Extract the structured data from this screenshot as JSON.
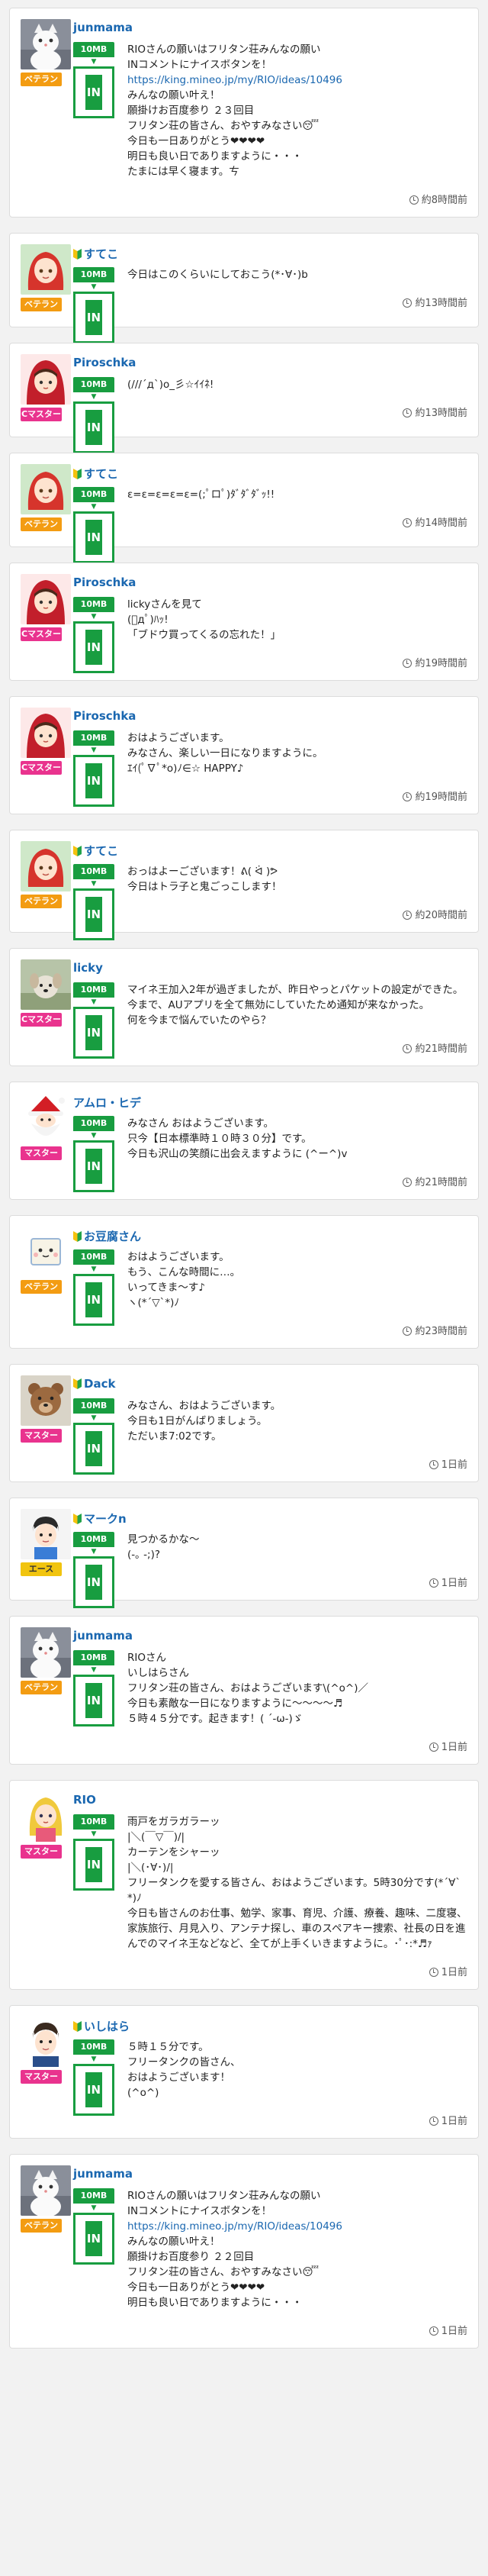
{
  "colors": {
    "veteran": "#f39c12",
    "master": "#e9338e",
    "ace": "#f1c40f",
    "mb_green": "#189d40",
    "username": "#1a67b0"
  },
  "posts": [
    {
      "user": "junmama",
      "beginner": false,
      "rank": "ベテラン",
      "rank_type": "veteran",
      "avatar": "cat-icon",
      "mb": "10MB",
      "in": "IN",
      "lines": [
        {
          "t": "RIOさんの願いはフリタン荘みんなの願い"
        },
        {
          "t": "INコメントにナイスボタンを！"
        },
        {
          "t": "https://king.mineo.jp/my/RIO/ideas/10496",
          "link": true
        },
        {
          "t": "みんなの願い叶え！"
        },
        {
          "t": "願掛けお百度参り ２３回目"
        },
        {
          "t": "フリタン荘の皆さん、おやすみなさい😴"
        },
        {
          "t": "今日も一日ありがとう❤❤❤❤"
        },
        {
          "t": "明日も良い日でありますように・・・"
        },
        {
          "t": "たまには早く寝ます。ㄘ"
        }
      ],
      "time": "約8時間前"
    },
    {
      "user": "すてこ",
      "beginner": true,
      "rank": "ベテラン",
      "rank_type": "veteran",
      "avatar": "red-hair-girl-icon",
      "mb": "10MB",
      "in": "IN",
      "lines": [
        {
          "t": "今日はこのくらいにしておこう(*･∀･)b"
        }
      ],
      "time": "約13時間前"
    },
    {
      "user": "Piroschka",
      "beginner": false,
      "rank": "Cマスター",
      "rank_type": "master",
      "avatar": "red-hood-girl-icon",
      "mb": "10MB",
      "in": "IN",
      "lines": [
        {
          "t": "(///´д`)o_彡☆ｲｲﾈ!"
        }
      ],
      "time": "約13時間前"
    },
    {
      "user": "すてこ",
      "beginner": true,
      "rank": "ベテラン",
      "rank_type": "veteran",
      "avatar": "red-hair-girl-icon",
      "mb": "10MB",
      "in": "IN",
      "lines": [
        {
          "t": "ε=ε=ε=ε=ε=(;ﾟロﾟ)ﾀﾞﾀﾞﾀﾞｯ!!"
        }
      ],
      "time": "約14時間前"
    },
    {
      "user": "Piroschka",
      "beginner": false,
      "rank": "Cマスター",
      "rank_type": "master",
      "avatar": "red-hood-girl-icon",
      "mb": "10MB",
      "in": "IN",
      "lines": [
        {
          "t": "lickyさんを見て"
        },
        {
          "t": "(ﾟдﾟ)ﾊｯ!"
        },
        {
          "t": "「ブドウ買ってくるの忘れた！」"
        }
      ],
      "time": "約19時間前"
    },
    {
      "user": "Piroschka",
      "beginner": false,
      "rank": "Cマスター",
      "rank_type": "master",
      "avatar": "red-hood-girl-icon",
      "mb": "10MB",
      "in": "IN",
      "lines": [
        {
          "t": "おはようございます。"
        },
        {
          "t": "みなさん、楽しい一日になりますように。"
        },
        {
          "t": "ｴｲ(ﾟ∇ﾟ*o)ﾉ∈☆ HAPPY♪"
        }
      ],
      "time": "約19時間前"
    },
    {
      "user": "すてこ",
      "beginner": true,
      "rank": "ベテラン",
      "rank_type": "veteran",
      "avatar": "red-hair-girl-icon",
      "mb": "10MB",
      "in": "IN",
      "lines": [
        {
          "t": "おっはよーございます！ᕕ( ᐛ )ᕗ"
        },
        {
          "t": "今日はトラ子と鬼ごっこします！"
        }
      ],
      "time": "約20時間前"
    },
    {
      "user": "licky",
      "beginner": false,
      "rank": "Cマスター",
      "rank_type": "master",
      "avatar": "dog-icon",
      "mb": "10MB",
      "in": "IN",
      "lines": [
        {
          "t": "マイネ王加入2年が過ぎましたが、昨日やっとパケットの設定ができた。"
        },
        {
          "t": "今まで、AUアプリを全て無効にしていたため通知が来なかった。"
        },
        {
          "t": "何を今まで悩んでいたのやら？"
        }
      ],
      "time": "約21時間前"
    },
    {
      "user": "アムロ・ヒデ",
      "beginner": false,
      "rank": "マスター",
      "rank_type": "master",
      "avatar": "santa-icon",
      "mb": "10MB",
      "in": "IN",
      "lines": [
        {
          "t": "みなさん おはようございます。"
        },
        {
          "t": "只今【日本標準時１０時３０分】です。"
        },
        {
          "t": "今日も沢山の笑顔に出会えますように (^ー^)v"
        }
      ],
      "time": "約21時間前"
    },
    {
      "user": "お豆腐さん",
      "beginner": true,
      "rank": "ベテラン",
      "rank_type": "veteran",
      "avatar": "tofu-icon",
      "mb": "10MB",
      "in": "IN",
      "lines": [
        {
          "t": "おはようございます。"
        },
        {
          "t": "もう、こんな時間に…。"
        },
        {
          "t": "いってきま〜す♪"
        },
        {
          "t": "ヽ(*´▽`*)ﾉ"
        }
      ],
      "time": "約23時間前"
    },
    {
      "user": "Dack",
      "beginner": true,
      "rank": "マスター",
      "rank_type": "master",
      "avatar": "bear-icon",
      "mb": "10MB",
      "in": "IN",
      "lines": [
        {
          "t": "みなさん、おはようございます。"
        },
        {
          "t": "今日も1日がんばりましょう。"
        },
        {
          "t": "ただいま7:02です。"
        }
      ],
      "time": "1日前"
    },
    {
      "user": "マークn",
      "beginner": true,
      "rank": "エース",
      "rank_type": "ace",
      "avatar": "boy-icon",
      "mb": "10MB",
      "in": "IN",
      "lines": [
        {
          "t": "見つかるかな〜"
        },
        {
          "t": "(-｡ -;)?"
        }
      ],
      "time": "1日前"
    },
    {
      "user": "junmama",
      "beginner": false,
      "rank": "ベテラン",
      "rank_type": "veteran",
      "avatar": "cat-icon",
      "mb": "10MB",
      "in": "IN",
      "lines": [
        {
          "t": "RIOさん"
        },
        {
          "t": "いしはらさん"
        },
        {
          "t": "フリタン荘の皆さん、おはようございます\\(^o^)／"
        },
        {
          "t": "今日も素敵な一日になりますように〜〜〜〜♬"
        },
        {
          "t": "５時４５分です。起きます！( ´-ω-)ゞ"
        }
      ],
      "time": "1日前"
    },
    {
      "user": "RIO",
      "beginner": false,
      "rank": "マスター",
      "rank_type": "master",
      "avatar": "blonde-girl-icon",
      "mb": "10MB",
      "in": "IN",
      "lines": [
        {
          "t": "雨戸をガラガラーッ"
        },
        {
          "t": "|＼(￣▽￣)/|"
        },
        {
          "t": "カーテンをシャーッ"
        },
        {
          "t": "|＼(･∀･)/|"
        },
        {
          "t": "フリータンクを愛する皆さん、おはようございます。5時30分です(*´∀`*)ﾉ"
        },
        {
          "t": "今日も皆さんのお仕事、勉学、家事、育児、介護、療養、趣味、二度寝、家族旅行、月見入り、アンテナ探し、車のスペアキー捜索、社長の日を進んでのマイネ王などなど、全てが上手くいきますように。･ﾟ･:*♬ｧ"
        }
      ],
      "time": "1日前"
    },
    {
      "user": "いしはら",
      "beginner": true,
      "rank": "マスター",
      "rank_type": "master",
      "avatar": "man-icon",
      "mb": "10MB",
      "in": "IN",
      "lines": [
        {
          "t": "５時１５分です。"
        },
        {
          "t": "フリータンクの皆さん、"
        },
        {
          "t": "おはようございます！"
        },
        {
          "t": "(^o^)"
        }
      ],
      "time": "1日前"
    },
    {
      "user": "junmama",
      "beginner": false,
      "rank": "ベテラン",
      "rank_type": "veteran",
      "avatar": "cat-icon",
      "mb": "10MB",
      "in": "IN",
      "lines": [
        {
          "t": "RIOさんの願いはフリタン荘みんなの願い"
        },
        {
          "t": "INコメントにナイスボタンを！"
        },
        {
          "t": "https://king.mineo.jp/my/RIO/ideas/10496",
          "link": true
        },
        {
          "t": "みんなの願い叶え！"
        },
        {
          "t": "願掛けお百度参り ２２回目"
        },
        {
          "t": "フリタン荘の皆さん、おやすみなさい😴"
        },
        {
          "t": "今日も一日ありがとう❤❤❤❤"
        },
        {
          "t": "明日も良い日でありますように・・・"
        }
      ],
      "time": "1日前"
    }
  ]
}
